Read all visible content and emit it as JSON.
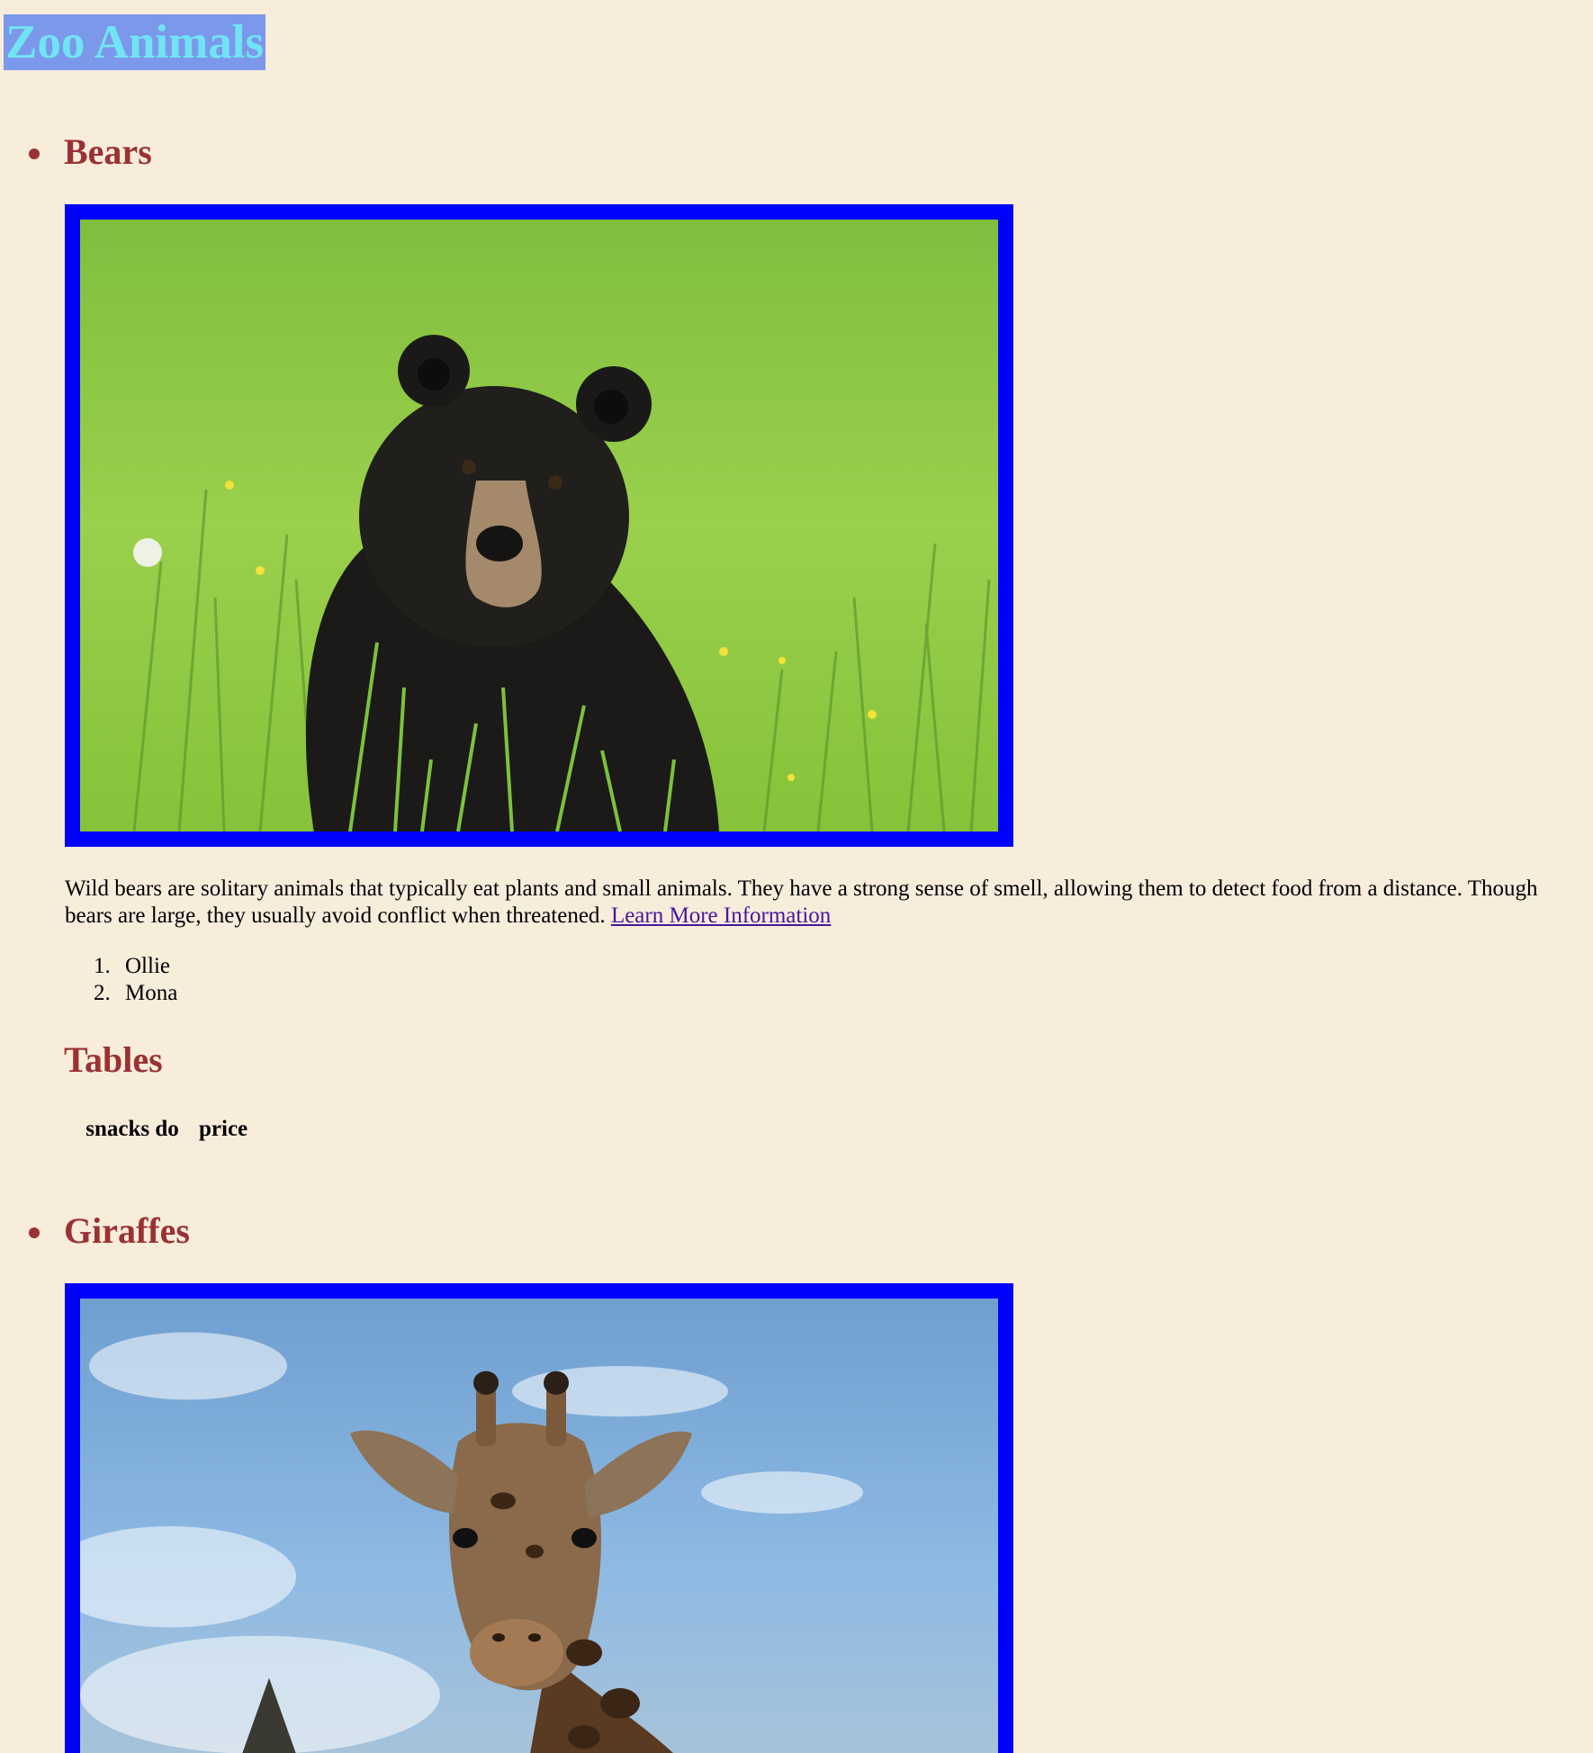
{
  "page": {
    "title": "Zoo Animals"
  },
  "animals": [
    {
      "heading": "Bears",
      "image_alt": "Black bear in tall green grass",
      "description_line1": "Wild bears are solitary animals that typically eat plants and small animals. They have a strong sense of smell, allowing them to detect food from a distance. Though",
      "description_line2": "bears are large, they usually avoid conflict when threatened. ",
      "link_text": "Learn More Information",
      "names": [
        {
          "number": "1.",
          "name": "Ollie"
        },
        {
          "number": "2.",
          "name": "Mona"
        }
      ],
      "table_heading": "Tables",
      "table_headers": [
        "snacks do",
        "price"
      ]
    },
    {
      "heading": "Giraffes",
      "image_alt": "Giraffe head against a blue cloudy sky"
    }
  ],
  "colors": {
    "background": "#f8ecdb",
    "title_text": "#71e4f4",
    "title_bg": "#7b98ea",
    "heading": "#9a3234",
    "image_border": "#0000ff",
    "link": "#43199a"
  }
}
